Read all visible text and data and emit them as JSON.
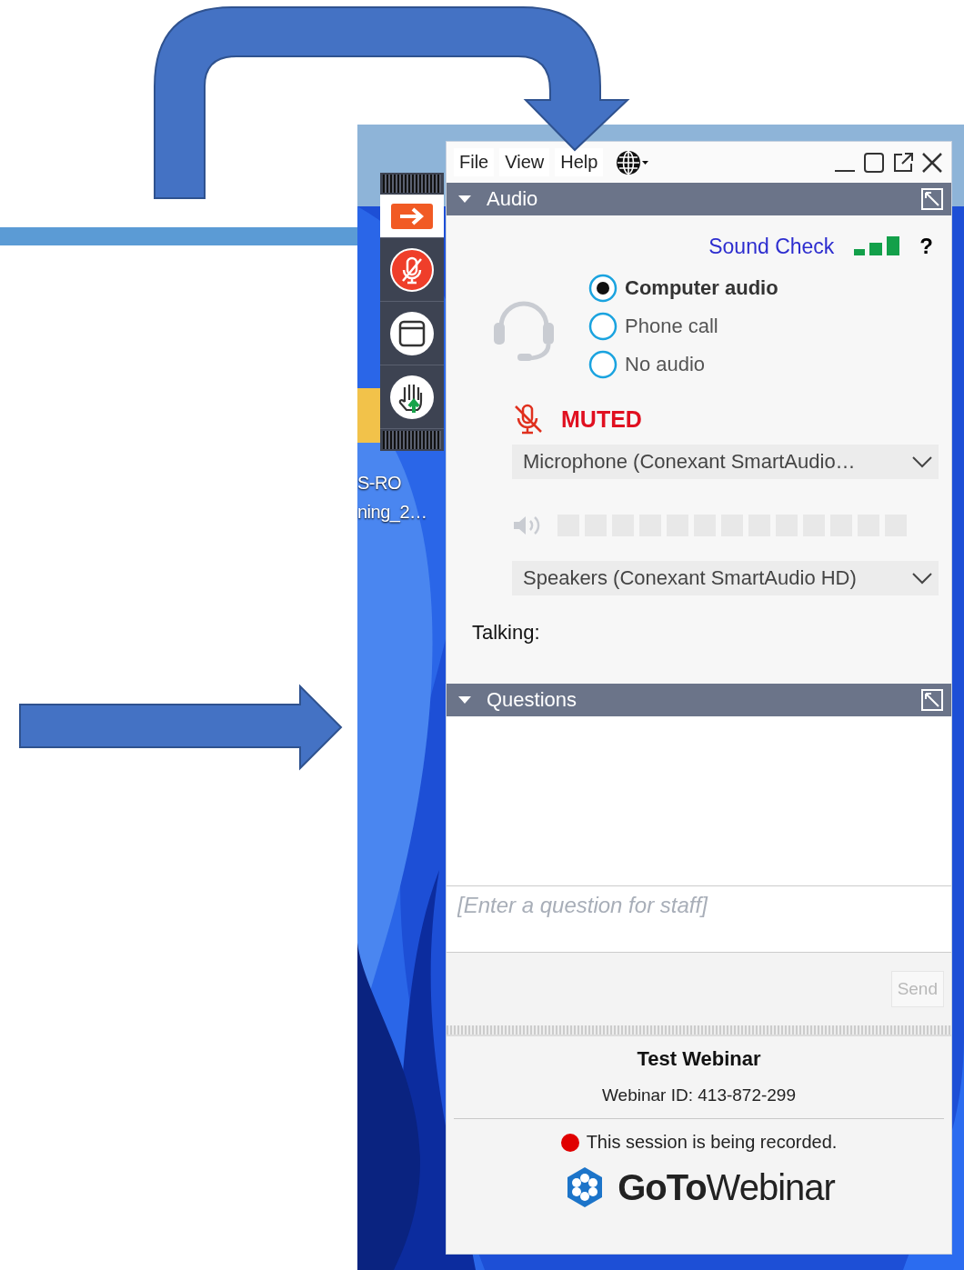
{
  "desktop": {
    "icon_label_lines": [
      "S-RO",
      "ning_2…"
    ]
  },
  "menu": [
    "File",
    "View",
    "Help"
  ],
  "audio": {
    "title": "Audio",
    "expanded": true,
    "sound_check": "Sound Check",
    "help": "?",
    "options": [
      {
        "label": "Computer audio",
        "selected": true
      },
      {
        "label": "Phone call",
        "selected": false
      },
      {
        "label": "No audio",
        "selected": false
      }
    ],
    "muted": true,
    "mute_status": "MUTED",
    "microphone": "Microphone (Conexant SmartAudio…",
    "speakers": "Speakers (Conexant SmartAudio HD)",
    "talking_label": "Talking:"
  },
  "questions": {
    "title": "Questions",
    "expanded": true,
    "placeholder": "[Enter a question for staff]",
    "send": "Send",
    "send_disabled": true
  },
  "footer": {
    "webinar_title": "Test Webinar",
    "webinar_id": "Webinar ID: 413-872-299",
    "recording_notice": "This session is being recorded.",
    "logo": "**GoTo**Webinar"
  }
}
